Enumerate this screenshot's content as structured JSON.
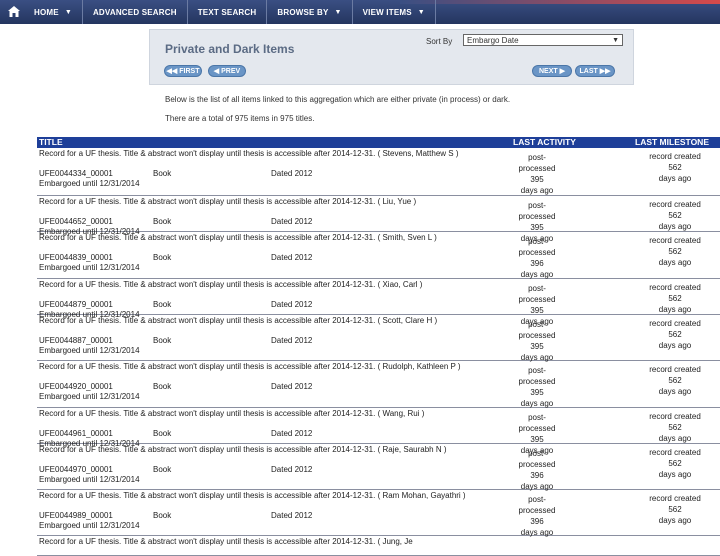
{
  "nav": {
    "items": [
      {
        "label": "HOME",
        "caret": "▼"
      },
      {
        "label": "ADVANCED SEARCH",
        "caret": ""
      },
      {
        "label": "TEXT SEARCH",
        "caret": ""
      },
      {
        "label": "BROWSE BY",
        "caret": "▼"
      },
      {
        "label": "VIEW ITEMS",
        "caret": "▼"
      }
    ]
  },
  "panel": {
    "title": "Private and Dark Items",
    "sort_label": "Sort By",
    "sort_value": "Embargo Date",
    "buttons": {
      "first": "◀◀ FIRST",
      "prev": "◀ PREV",
      "next": "NEXT ▶",
      "last": "LAST ▶▶"
    }
  },
  "info": {
    "line1": "Below is the list of all items linked to this aggregation which are either private (in process) or dark.",
    "line2": "There are a total of 975 items in 975 titles."
  },
  "table": {
    "headers": {
      "title": "TITLE",
      "last_activity": "LAST ACTIVITY",
      "last_milestone": "LAST MILESTONE"
    },
    "rows": [
      {
        "desc": "Record for a UF thesis. Title & abstract won't display until thesis is accessible after 2014-12-31. ( Stevens, Matthew S )",
        "bibid": "UFE0044334_00001",
        "type": "Book",
        "dated": "Dated 2012",
        "embargo": "Embargoed until 12/31/2014",
        "activity": "post-processed",
        "activity_days": "395",
        "activity_unit": "days ago",
        "milestone": "record created",
        "milestone_days": "562",
        "milestone_unit": "days ago"
      },
      {
        "desc": "Record for a UF thesis. Title & abstract won't display until thesis is accessible after 2014-12-31. ( Liu, Yue )",
        "bibid": "UFE0044652_00001",
        "type": "Book",
        "dated": "Dated 2012",
        "embargo": "Embargoed until 12/31/2014",
        "activity": "post-processed",
        "activity_days": "395",
        "activity_unit": "days ago",
        "milestone": "record created",
        "milestone_days": "562",
        "milestone_unit": "days ago"
      },
      {
        "desc": "Record for a UF thesis. Title & abstract won't display until thesis is accessible after 2014-12-31. ( Smith, Sven L )",
        "bibid": "UFE0044839_00001",
        "type": "Book",
        "dated": "Dated 2012",
        "embargo": "Embargoed until 12/31/2014",
        "activity": "post-processed",
        "activity_days": "396",
        "activity_unit": "days ago",
        "milestone": "record created",
        "milestone_days": "562",
        "milestone_unit": "days ago"
      },
      {
        "desc": "Record for a UF thesis. Title & abstract won't display until thesis is accessible after 2014-12-31. ( Xiao, Carl )",
        "bibid": "UFE0044879_00001",
        "type": "Book",
        "dated": "Dated 2012",
        "embargo": "Embargoed until 12/31/2014",
        "activity": "post-processed",
        "activity_days": "395",
        "activity_unit": "days ago",
        "milestone": "record created",
        "milestone_days": "562",
        "milestone_unit": "days ago"
      },
      {
        "desc": "Record for a UF thesis. Title & abstract won't display until thesis is accessible after 2014-12-31. ( Scott, Clare H )",
        "bibid": "UFE0044887_00001",
        "type": "Book",
        "dated": "Dated 2012",
        "embargo": "Embargoed until 12/31/2014",
        "activity": "post-processed",
        "activity_days": "395",
        "activity_unit": "days ago",
        "milestone": "record created",
        "milestone_days": "562",
        "milestone_unit": "days ago"
      },
      {
        "desc": "Record for a UF thesis. Title & abstract won't display until thesis is accessible after 2014-12-31. ( Rudolph, Kathleen P )",
        "bibid": "UFE0044920_00001",
        "type": "Book",
        "dated": "Dated 2012",
        "embargo": "Embargoed until 12/31/2014",
        "activity": "post-processed",
        "activity_days": "395",
        "activity_unit": "days ago",
        "milestone": "record created",
        "milestone_days": "562",
        "milestone_unit": "days ago"
      },
      {
        "desc": "Record for a UF thesis. Title & abstract won't display until thesis is accessible after 2014-12-31. ( Wang, Rui )",
        "bibid": "UFE0044961_00001",
        "type": "Book",
        "dated": "Dated 2012",
        "embargo": "Embargoed until 12/31/2014",
        "activity": "post-processed",
        "activity_days": "395",
        "activity_unit": "days ago",
        "milestone": "record created",
        "milestone_days": "562",
        "milestone_unit": "days ago"
      },
      {
        "desc": "Record for a UF thesis. Title & abstract won't display until thesis is accessible after 2014-12-31. ( Raje, Saurabh N )",
        "bibid": "UFE0044970_00001",
        "type": "Book",
        "dated": "Dated 2012",
        "embargo": "Embargoed until 12/31/2014",
        "activity": "post-processed",
        "activity_days": "396",
        "activity_unit": "days ago",
        "milestone": "record created",
        "milestone_days": "562",
        "milestone_unit": "days ago"
      },
      {
        "desc": "Record for a UF thesis. Title & abstract won't display until thesis is accessible after 2014-12-31. ( Ram Mohan, Gayathri )",
        "bibid": "UFE0044989_00001",
        "type": "Book",
        "dated": "Dated 2012",
        "embargo": "Embargoed until 12/31/2014",
        "activity": "post-processed",
        "activity_days": "396",
        "activity_unit": "days ago",
        "milestone": "record created",
        "milestone_days": "562",
        "milestone_unit": "days ago"
      },
      {
        "desc": "Record for a UF thesis. Title & abstract won't display until thesis is accessible after 2014-12-31. ( Jung, Je",
        "bibid": "",
        "type": "",
        "dated": "",
        "embargo": "",
        "activity": "",
        "activity_days": "",
        "activity_unit": "",
        "milestone": "",
        "milestone_days": "",
        "milestone_unit": ""
      }
    ]
  }
}
